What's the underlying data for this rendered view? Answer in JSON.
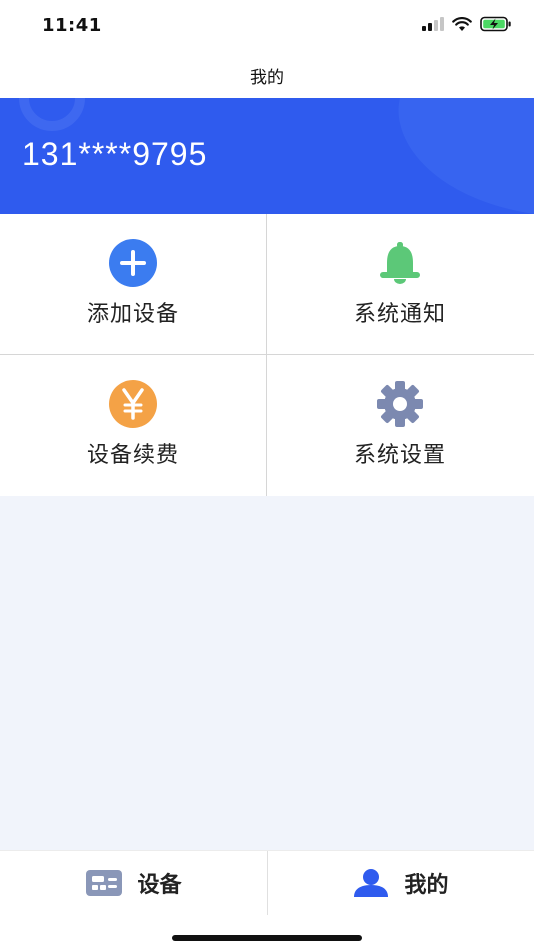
{
  "status_bar": {
    "time": "11:41",
    "icons": [
      "signal-icon",
      "wifi-icon",
      "battery-charging-icon"
    ]
  },
  "nav": {
    "title": "我的"
  },
  "profile": {
    "phone": "131****9795",
    "banner_color": "#2f5bee"
  },
  "menu": {
    "items": [
      {
        "label": "添加设备",
        "icon": "add-icon",
        "color": "#3b7cf0"
      },
      {
        "label": "系统通知",
        "icon": "bell-icon",
        "color": "#5cc878"
      },
      {
        "label": "设备续费",
        "icon": "yen-icon",
        "color": "#f4a246"
      },
      {
        "label": "系统设置",
        "icon": "gear-icon",
        "color": "#7c89b0"
      }
    ]
  },
  "tabs": [
    {
      "label": "设备",
      "icon": "device-icon",
      "color": "#8a97b8"
    },
    {
      "label": "我的",
      "icon": "user-icon",
      "color": "#2f5bee",
      "active": true
    }
  ]
}
